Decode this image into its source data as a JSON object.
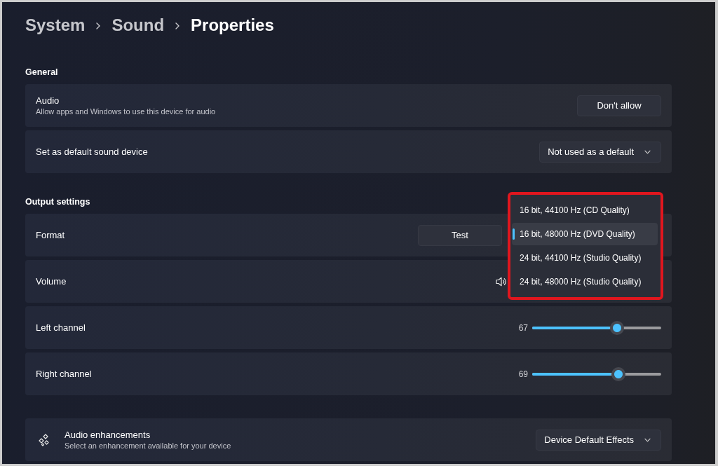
{
  "breadcrumb": [
    {
      "label": "System",
      "current": false
    },
    {
      "label": "Sound",
      "current": false
    },
    {
      "label": "Properties",
      "current": true
    }
  ],
  "sections": [
    {
      "title": "General",
      "rows": [
        {
          "kind": "button",
          "title": "Audio",
          "subtitle": "Allow apps and Windows to use this device for audio",
          "control": {
            "label": "Don't allow"
          }
        },
        {
          "kind": "dropdown",
          "title": "Set as default sound device",
          "control": {
            "label": "Not used as a default"
          }
        }
      ]
    },
    {
      "title": "Output settings",
      "rows": [
        {
          "kind": "button",
          "title": "Format",
          "control": {
            "label": "Test"
          },
          "menu": {
            "options": [
              {
                "label": "16 bit, 44100 Hz (CD Quality)",
                "selected": false
              },
              {
                "label": "16 bit, 48000 Hz (DVD Quality)",
                "selected": true
              },
              {
                "label": "24 bit, 44100 Hz (Studio Quality)",
                "selected": false
              },
              {
                "label": "24 bit, 48000 Hz (Studio Quality)",
                "selected": false
              }
            ]
          }
        },
        {
          "kind": "volume",
          "title": "Volume"
        },
        {
          "kind": "slider",
          "title": "Left channel",
          "reading": "67",
          "level": 0.66
        },
        {
          "kind": "slider",
          "title": "Right channel",
          "reading": "69",
          "level": 0.67
        }
      ]
    },
    {
      "rows": [
        {
          "kind": "dropdown",
          "leading_icon": true,
          "title": "Audio enhancements",
          "subtitle": "Select an enhancement available for your device",
          "control": {
            "label": "Device Default Effects"
          }
        }
      ]
    }
  ]
}
